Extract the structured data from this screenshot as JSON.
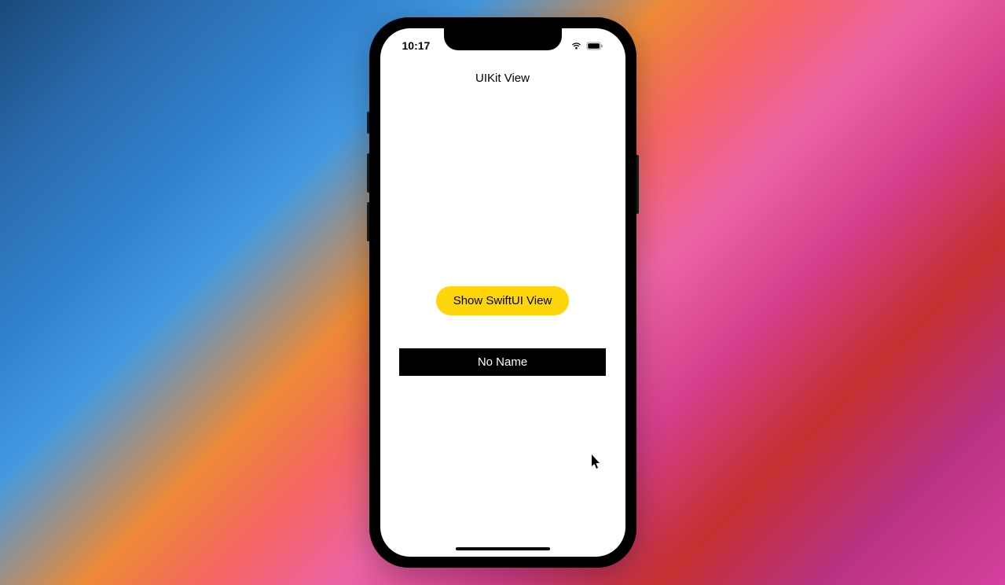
{
  "status": {
    "time": "10:17"
  },
  "nav": {
    "title": "UIKit View"
  },
  "content": {
    "button_label": "Show SwiftUI View",
    "name_label": "No Name"
  }
}
